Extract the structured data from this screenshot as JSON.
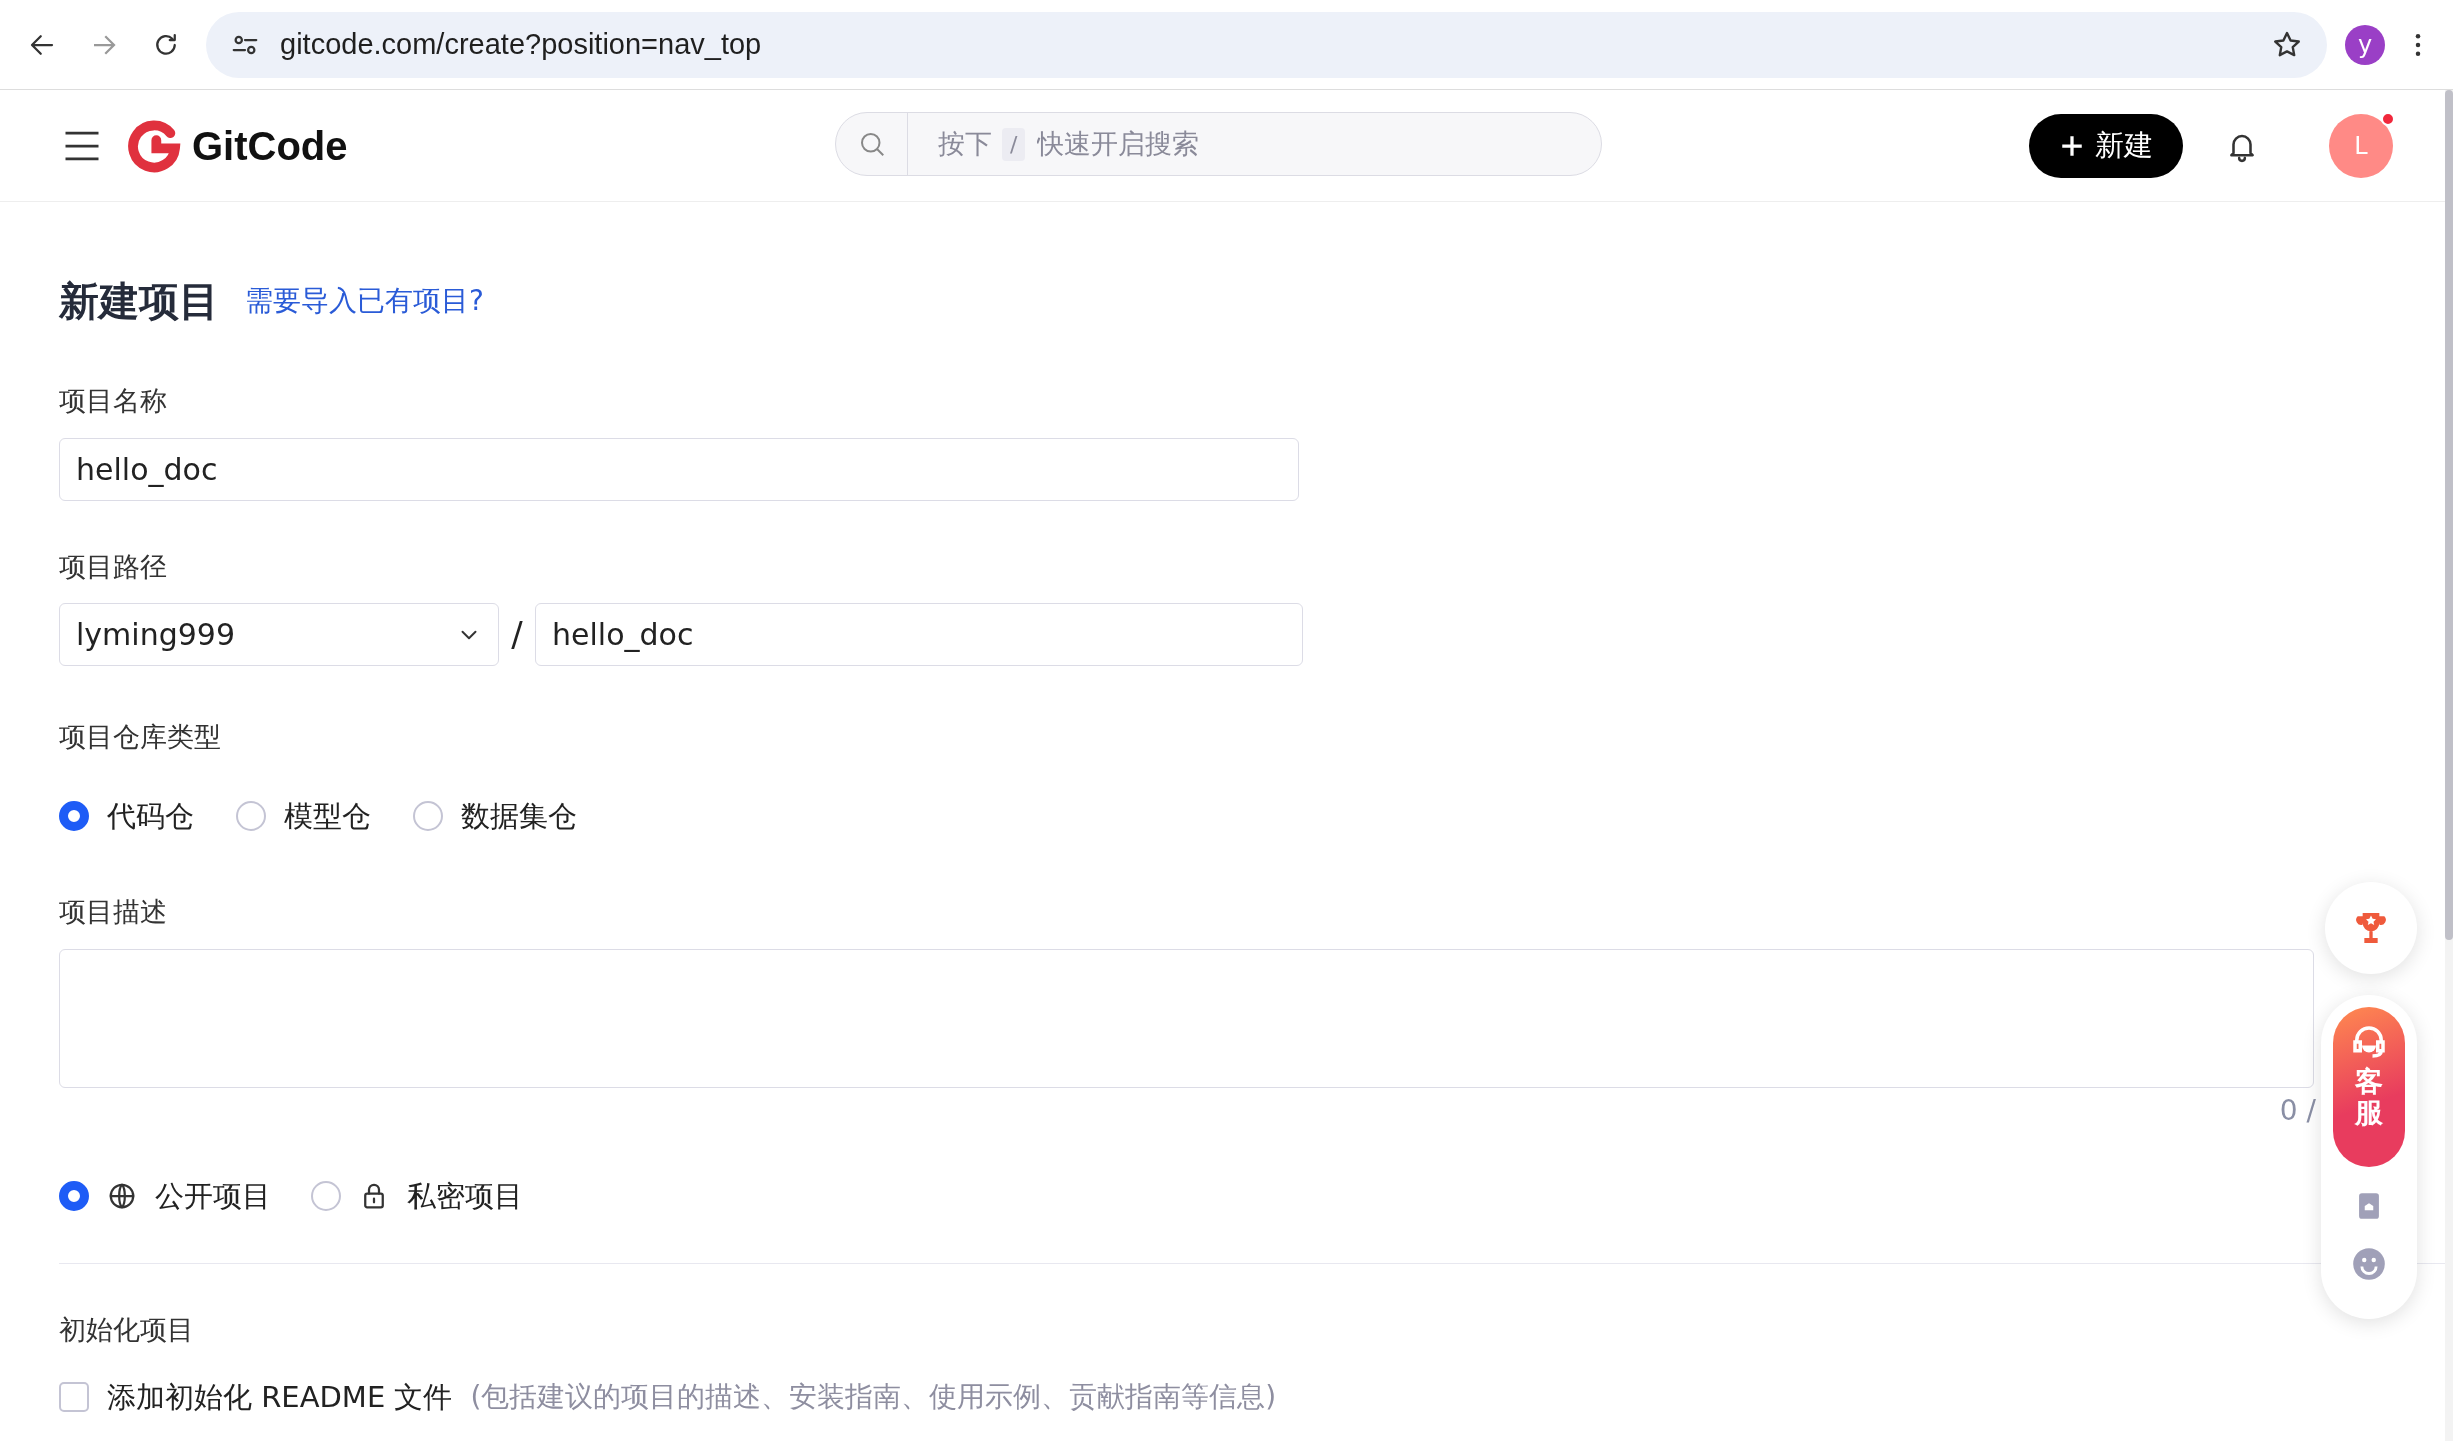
{
  "browser": {
    "url": "gitcode.com/create?position=nav_top",
    "profile_initial": "y"
  },
  "header": {
    "logo": "GitCode",
    "search": {
      "hint": "按下",
      "key": "/",
      "placeholder": "快速开启搜索"
    },
    "new_button": "新建",
    "avatar_initial": "L",
    "notification_dot": true
  },
  "form": {
    "title": "新建项目",
    "import_link": "需要导入已有项目?",
    "name_field": {
      "label": "项目名称",
      "value": "hello_doc"
    },
    "path": {
      "label": "项目路径",
      "namespace": "lyming999",
      "separator": "/",
      "value": "hello_doc"
    },
    "repo_type": {
      "label": "项目仓库类型",
      "options": [
        {
          "label": "代码仓",
          "selected": true
        },
        {
          "label": "模型仓",
          "selected": false
        },
        {
          "label": "数据集仓",
          "selected": false
        }
      ]
    },
    "description": {
      "label": "项目描述",
      "counter": "0 /"
    },
    "visibility": [
      {
        "label": "公开项目",
        "selected": true,
        "kind": "globe"
      },
      {
        "label": "私密项目",
        "selected": false,
        "kind": "lock"
      }
    ],
    "init": {
      "label": "初始化项目",
      "options": [
        {
          "label": "添加初始化 README 文件",
          "hint": "(包括建议的项目的描述、安装指南、使用示例、贡献指南等信息)",
          "checked": false
        }
      ]
    }
  },
  "float_bar": {
    "service_label": "客服"
  }
}
